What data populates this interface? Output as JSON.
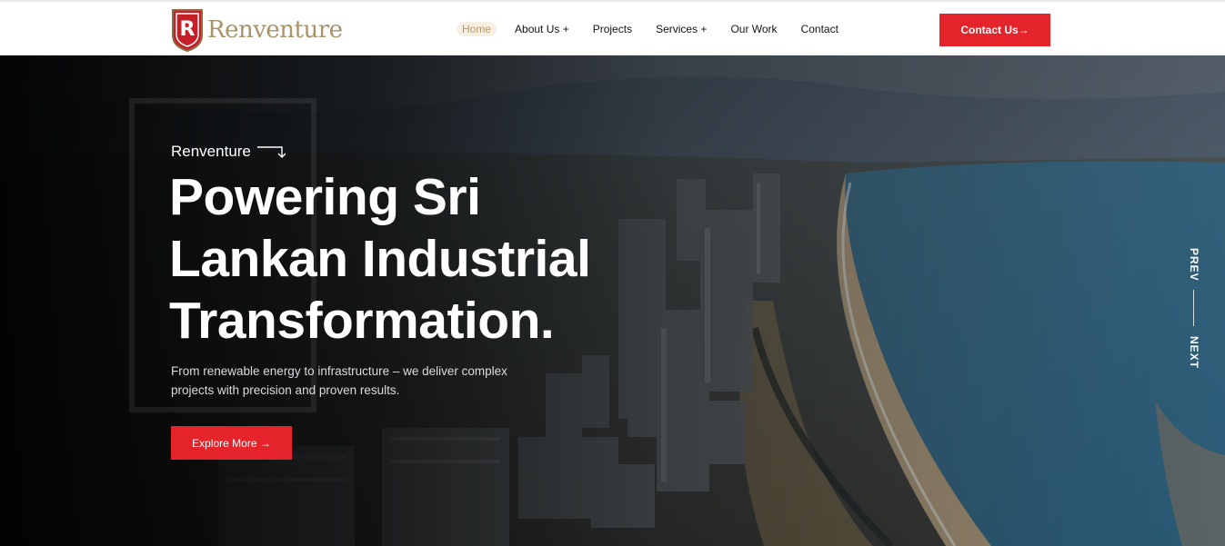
{
  "brand": {
    "name": "Renventure",
    "logo_letter": "R",
    "accent_color": "#e5232b",
    "logo_gold": "#a8936a"
  },
  "nav": {
    "items": [
      {
        "label": "Home",
        "active": true
      },
      {
        "label": "About Us +"
      },
      {
        "label": "Projects"
      },
      {
        "label": "Services +"
      },
      {
        "label": "Our Work"
      },
      {
        "label": "Contact"
      }
    ],
    "cta_label": "Contact Us→"
  },
  "hero": {
    "eyebrow": "Renventure",
    "headline": [
      "Powering Sri",
      "Lankan Industrial",
      "Transformation."
    ],
    "lead": "From renewable energy to infrastructure – we deliver complex projects with precision and proven results.",
    "button_label": "Explore More →",
    "prev_label": "PREV",
    "next_label": "NEXT",
    "background": "aerial-city-coastline-image"
  }
}
